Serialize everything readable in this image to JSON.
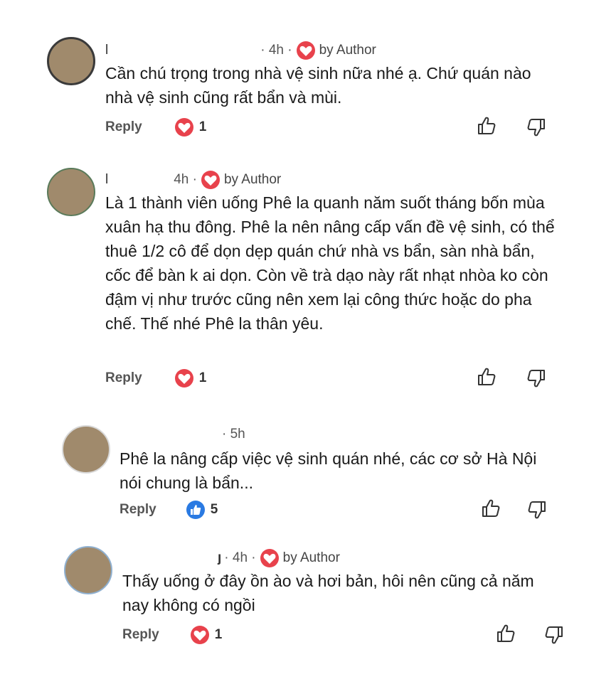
{
  "comments": [
    {
      "name": "l",
      "time": "· 4h ·",
      "author_tag": "by Author",
      "text": "Cần chú trọng trong nhà vệ sinh nữa nhé ạ. Chứ quán nào nhà vệ sinh cũng rất bẩn và mùi.",
      "reply_label": "Reply",
      "reaction_icon": "heart-reaction-icon",
      "reaction_count": "1"
    },
    {
      "name": "l",
      "time": "4h ·",
      "author_tag": "by Author",
      "text": "Là 1 thành viên uống Phê la quanh năm suốt tháng bốn mùa xuân hạ thu đông. Phê la nên nâng cấp vấn đề vệ sinh, có thể thuê 1/2 cô để dọn dẹp quán chứ nhà vs bẩn, sàn nhà bẩn, cốc để bàn k ai dọn. Còn về trà dạo này rất nhạt nhòa ko còn đậm vị như trước cũng nên xem lại công thức hoặc do pha chế. Thế nhé Phê la thân yêu.",
      "reply_label": "Reply",
      "reaction_icon": "heart-reaction-icon",
      "reaction_count": "1"
    },
    {
      "name": "",
      "time": "· 5h",
      "author_tag": "",
      "text": "Phê la nâng cấp việc vệ sinh quán nhé, các cơ sở Hà Nội nói chung là bẩn...",
      "reply_label": "Reply",
      "reaction_icon": "thumbs-up-reaction-icon",
      "reaction_count": "5"
    },
    {
      "name": "ȷ",
      "time": "· 4h ·",
      "author_tag": "by Author",
      "text": "Thấy uống ở đây ồn ào và hơi bản, hôi nên cũng cả năm nay không có ngồi",
      "reply_label": "Reply",
      "reaction_icon": "heart-reaction-icon",
      "reaction_count": "1"
    }
  ],
  "colors": {
    "heart": "#e8424c",
    "like": "#2a7ae2",
    "avatar": "#a08a6c"
  }
}
